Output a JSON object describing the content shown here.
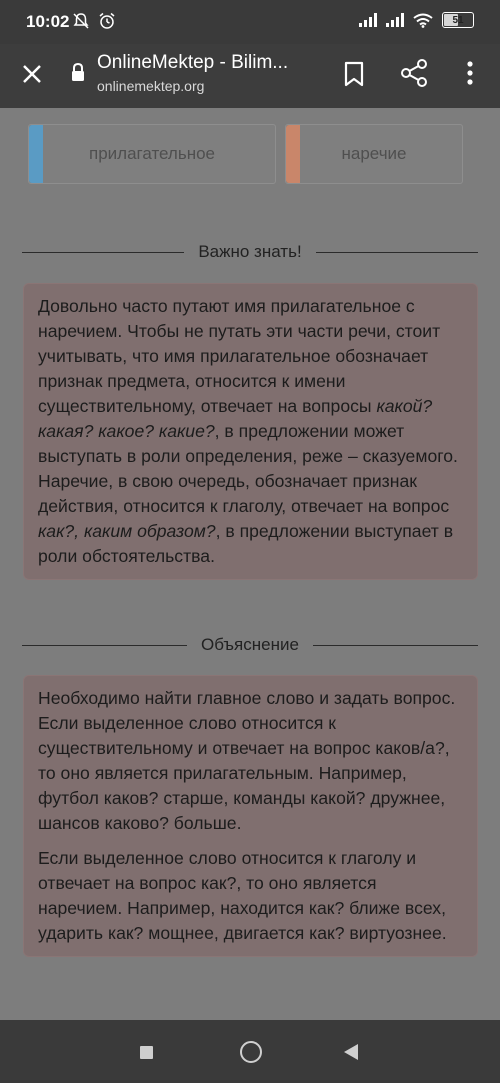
{
  "status_bar": {
    "time": "10:02",
    "battery": "51",
    "icons": [
      "mute-icon",
      "alarm-icon",
      "signal-icon",
      "signal-icon",
      "wifi-icon",
      "battery-icon"
    ]
  },
  "browser": {
    "title": "OnlineMektep - Bilim...",
    "url": "onlinemektep.org"
  },
  "options": [
    {
      "label": "прилагательное",
      "color": "#5a9bc4"
    },
    {
      "label": "наречие",
      "color": "#c9866a"
    }
  ],
  "important": {
    "heading": "Важно знать!",
    "text_1": "Довольно часто путают имя прилагательное с наречием. Чтобы не путать эти части речи, стоит учитывать, что имя прилагательное обозначает признак предмета, относится к имени существительному, отвечает на вопросы ",
    "italic_1": "какой? какая? какое? какие?",
    "text_2": ", в предложении может выступать в роли определения, реже – сказуемого. Наречие, в свою очередь, обозначает признак действия, относится к глаголу, отвечает на вопрос ",
    "italic_2": "как?, каким образом?",
    "text_3": ", в предложении выступает в роли обстоятельства."
  },
  "explanation": {
    "heading": "Объяснение",
    "paragraph_1": "Необходимо найти главное слово и задать вопрос. Если выделенное слово относится к существительному и отвечает на вопрос каков/а?, то оно является прилагательным. Например, футбол каков? старше, команды какой? дружнее, шансов каково? больше.",
    "paragraph_2": "Если выделенное слово относится к глаголу и отвечает на вопрос как?, то оно является наречием. Например, находится как? ближе всех, ударить как? мощнее, двигается как? виртуознее."
  }
}
